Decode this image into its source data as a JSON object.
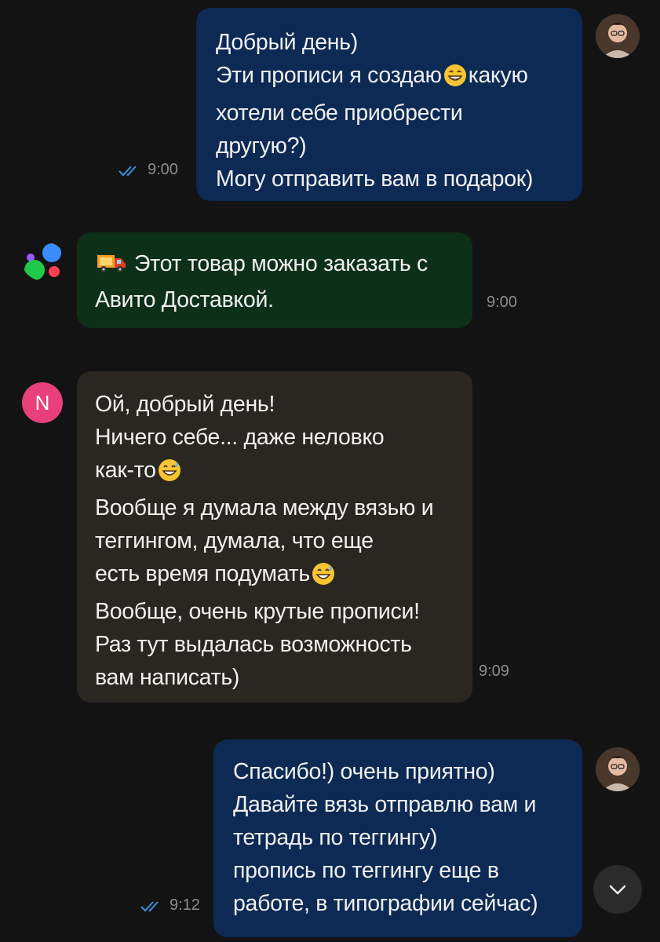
{
  "messages": [
    {
      "id": "m1",
      "direction": "outgoing",
      "lines": [
        "Добрый день)",
        "Эти прописи я создаю",
        "какую",
        "хотели себе приобрести",
        "другую?)",
        "Могу отправить вам в подарок)"
      ],
      "time": "9:00",
      "status": "read"
    },
    {
      "id": "m2",
      "direction": "system",
      "lines": [
        "Этот товар можно заказать с",
        "Авито Доставкой."
      ],
      "time": "9:00",
      "icon": "delivery-truck-icon"
    },
    {
      "id": "m3",
      "direction": "incoming",
      "sender_initial": "N",
      "lines": [
        "Ой, добрый день!",
        "Ничего себе... даже неловко",
        "как-то",
        "Вообще я думала между вязью и",
        "теггингом, думала, что еще",
        "есть время подумать",
        "Вообще, очень крутые прописи!",
        "Раз тут выдалась возможность",
        "вам написать)"
      ],
      "time": "9:09"
    },
    {
      "id": "m4",
      "direction": "outgoing",
      "lines": [
        "Спасибо!) очень приятно)",
        "Давайте вязь отправлю вам и",
        "тетрадь по теггингу)",
        "пропись по теггингу еще в",
        "работе, в типографии сейчас)"
      ],
      "time": "9:12",
      "status": "read"
    }
  ],
  "icons": {
    "read_receipt": "double-check-icon",
    "grin": "grinning-face-emoji",
    "sweat": "grinning-face-with-sweat-emoji",
    "scroll_down": "chevron-down-icon",
    "avito_logo": "avito-logo-icon"
  },
  "colors": {
    "background": "#131314",
    "outgoing_bubble": "#0c2a54",
    "system_bubble": "#0d3018",
    "incoming_bubble": "#2a2723",
    "read_check": "#3d8fe0",
    "avatar_n": "#e8407a"
  }
}
